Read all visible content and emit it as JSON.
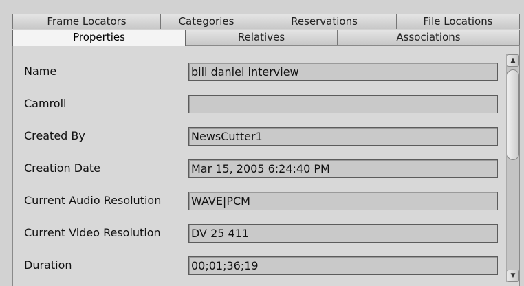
{
  "tabs_back": [
    {
      "label": "Frame Locators"
    },
    {
      "label": "Categories"
    },
    {
      "label": "Reservations"
    },
    {
      "label": "File Locations"
    }
  ],
  "tabs_front": [
    {
      "label": "Properties",
      "active": true
    },
    {
      "label": "Relatives"
    },
    {
      "label": "Associations"
    }
  ],
  "properties": [
    {
      "label": "Name",
      "value": "bill daniel interview"
    },
    {
      "label": "Camroll",
      "value": ""
    },
    {
      "label": "Created By",
      "value": "NewsCutter1"
    },
    {
      "label": "Creation Date",
      "value": "Mar 15, 2005 6:24:40 PM"
    },
    {
      "label": "Current Audio Resolution",
      "value": "WAVE|PCM"
    },
    {
      "label": "Current Video Resolution",
      "value": "DV 25 411"
    },
    {
      "label": "Duration",
      "value": "00;01;36;19"
    }
  ],
  "scrollbar": {
    "up_icon": "triangle-up-icon",
    "down_icon": "triangle-down-icon"
  }
}
